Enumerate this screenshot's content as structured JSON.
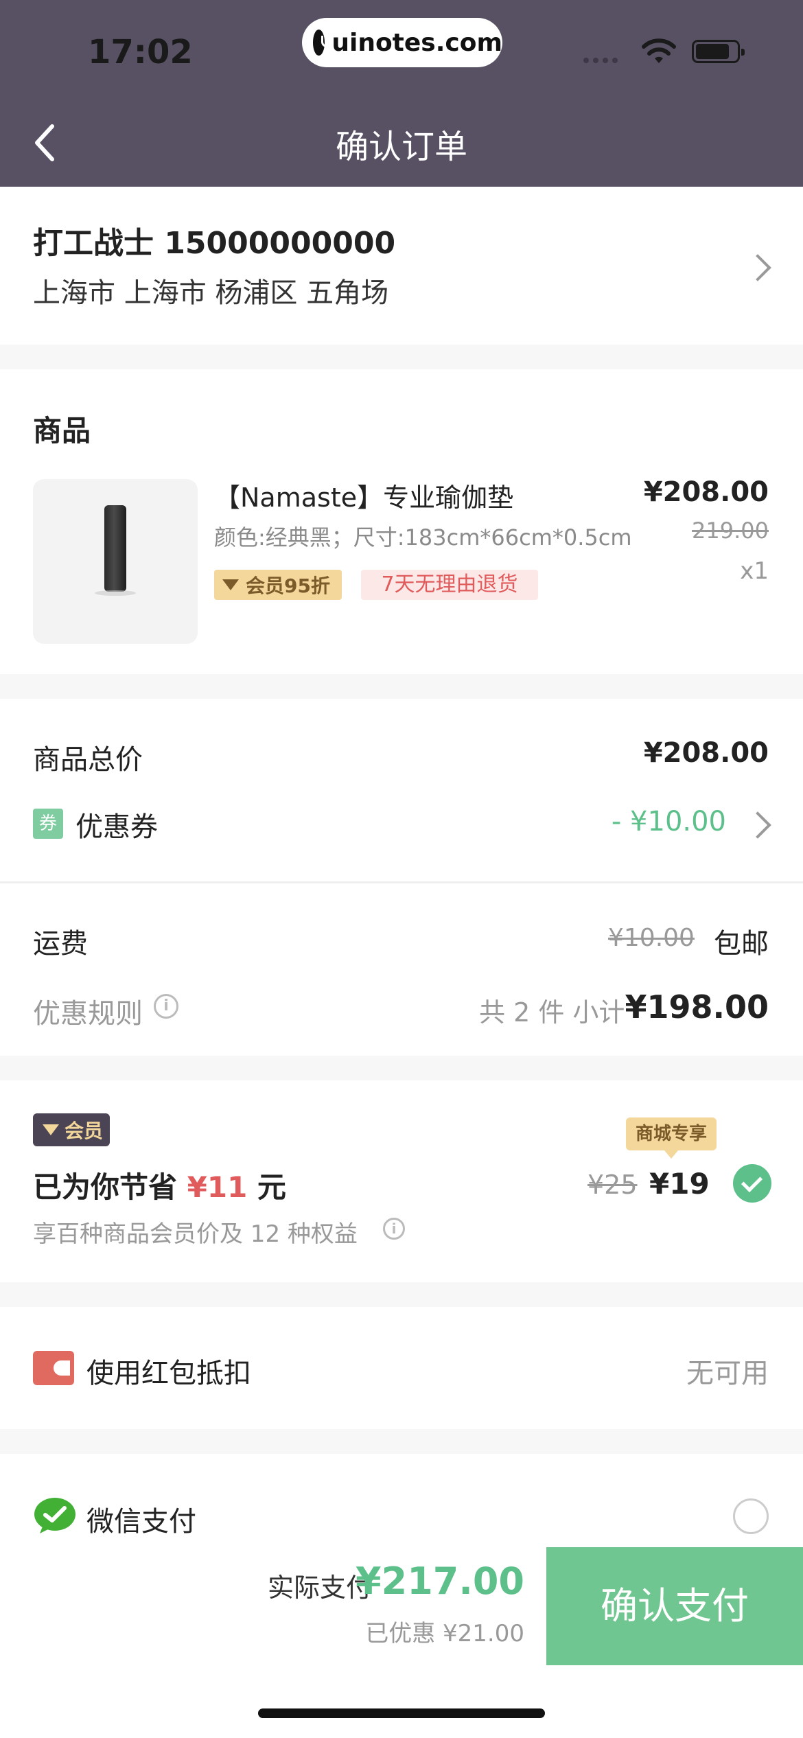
{
  "status_bar": {
    "time": "17:02",
    "url": "uinotes.com"
  },
  "nav": {
    "title": "确认订单"
  },
  "address": {
    "name_phone": "打工战士  15000000000",
    "line": "上海市 上海市 杨浦区 五角场"
  },
  "goods": {
    "section_title": "商品",
    "product": {
      "title": "【Namaste】专业瑜伽垫",
      "spec": "颜色:经典黑；尺寸:183cm*66cm*0.5cm",
      "member_tag": "会员95折",
      "return_tag": "7天无理由退货",
      "price": "¥208.00",
      "original_price": "219.00",
      "qty": "x1"
    }
  },
  "totals": {
    "goods_total_label": "商品总价",
    "goods_total_value": "¥208.00",
    "coupon_icon_text": "券",
    "coupon_label": "优惠券",
    "coupon_value": "- ¥10.00",
    "shipping_label": "运费",
    "shipping_original": "¥10.00",
    "shipping_value": "包邮",
    "rules_label": "优惠规则",
    "count_label": "共 2 件 小计",
    "subtotal": "¥198.00"
  },
  "membership": {
    "badge": "会员",
    "save_prefix": "已为你节省 ",
    "save_amount": "¥11",
    "save_suffix": " 元",
    "desc": "享百种商品会员价及 12 种权益",
    "mall_tag": "商城专享",
    "original_price": "¥25",
    "price": "¥19",
    "selected": true
  },
  "red_packet": {
    "label": "使用红包抵扣",
    "value": "无可用"
  },
  "payment": {
    "wechat_label": "微信支付",
    "selected": false
  },
  "bottom": {
    "pay_label": "实际支付",
    "pay_amount": "¥217.00",
    "discount_text": "已优惠 ¥21.00",
    "confirm_button": "确认支付"
  },
  "colors": {
    "accent_green": "#5dc08b",
    "button_green": "#70c690",
    "header_purple": "#585163",
    "red": "#e05b5b",
    "gold": "#f4d79a"
  },
  "icons": [
    "back-icon",
    "wifi-icon",
    "battery-icon",
    "chevron-right-icon",
    "info-icon",
    "check-icon",
    "red-packet-icon",
    "wechat-icon"
  ]
}
